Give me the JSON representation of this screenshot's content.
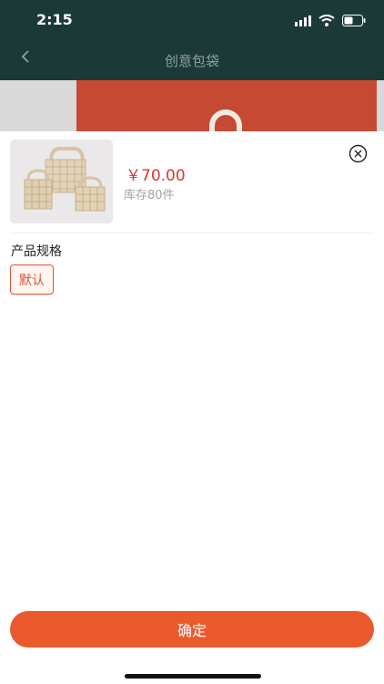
{
  "status": {
    "time": "2:15"
  },
  "nav": {
    "title": "创意包袋"
  },
  "sheet": {
    "price": "￥70.00",
    "stock": "库存80件",
    "spec_label": "产品规格",
    "spec_options": [
      "默认"
    ],
    "confirm_label": "确定"
  },
  "icons": {
    "back": "chevron-left-icon",
    "close": "close-circle-icon",
    "signal": "signal-icon",
    "wifi": "wifi-icon",
    "battery": "battery-icon"
  },
  "colors": {
    "header": "#1b3a37",
    "accent": "#eb5a2c",
    "price": "#d9372e"
  }
}
